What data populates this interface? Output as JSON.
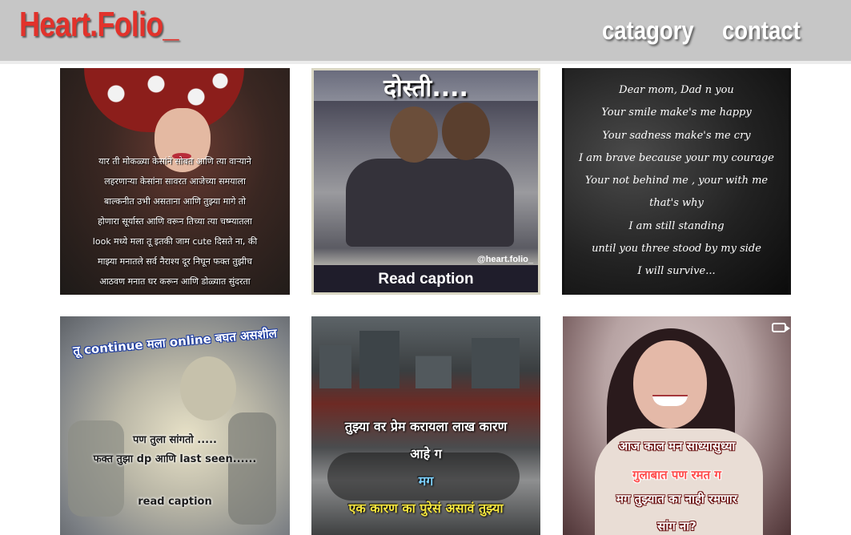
{
  "header": {
    "logo": "Heart.Folio_",
    "nav": [
      {
        "label": "catagory"
      },
      {
        "label": "contact"
      }
    ]
  },
  "posts": [
    {
      "lines": [
        "यार ती मोकळ्या केसांने सोबत आणि त्या वाऱ्याने",
        "लहरणाऱ्या केसांना सावरत आजेच्या समयाला",
        "बाल्कनीत उभी असताना आणि तुझ्या मागे तो",
        "होणारा सूर्यास्त आणि वरून तिच्या त्या चष्म्यातला",
        "look मध्ये मला तू इतकी जाम cute दिसते ना, की",
        "माझ्या मनातले सर्व नैराश्य दूर निघून फक्त तुझीच",
        "आठवण मनात घर करून आणि डोळ्यात सुंदरता"
      ]
    },
    {
      "title": "दोस्ती....",
      "handle": "@heart.folio_",
      "footer": "Read caption"
    },
    {
      "lines": [
        "Dear mom, Dad n you",
        "Your smile  make's me happy",
        "Your sadness make's me cry",
        "I am brave because your my courage",
        "Your not behind me , your with me",
        "that's why",
        "I am still standing",
        "until  you three  stood by my side",
        "I will survive..."
      ]
    },
    {
      "arc": "तू continue मला online बघत असशील",
      "lines": [
        "पण तुला सांगतो .....",
        "फक्त तुझा dp आणि last seen......"
      ],
      "footer": "read caption"
    },
    {
      "lines": [
        "तुझ्या वर प्रेम करायला लाख कारण",
        "आहे ग",
        "मग",
        "एक कारण का पुरेसं असावं तुझ्या"
      ]
    },
    {
      "lines": [
        "आज काल मन साध्यासुध्या",
        "गुलाबात पण रमत ग",
        "मग तुझ्यात का नाही रमणार",
        "सांग ना?"
      ]
    }
  ]
}
